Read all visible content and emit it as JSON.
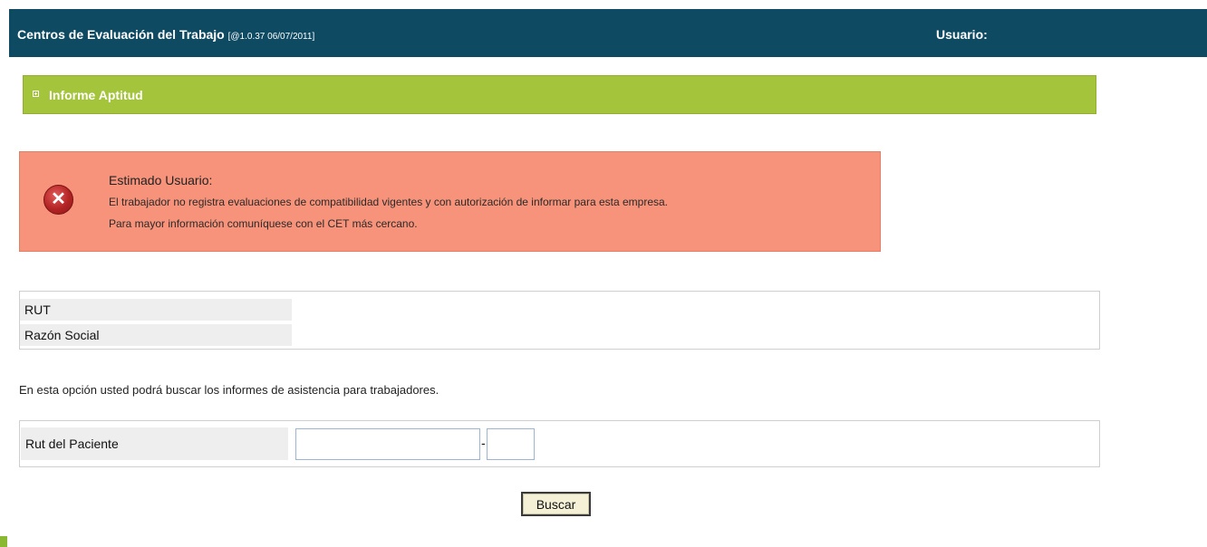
{
  "header": {
    "title": "Centros de Evaluación del Trabajo",
    "version": "[@1.0.37 06/07/2011]",
    "user_label": "Usuario:"
  },
  "section": {
    "title": "Informe Aptitud"
  },
  "alert": {
    "type": "error",
    "title": "Estimado Usuario:",
    "line1": "El trabajador no registra evaluaciones de compatibilidad vigentes y con autorización de informar para esta empresa.",
    "line2": "Para mayor información comuníquese con el CET más cercano."
  },
  "company": {
    "rut_label": "RUT",
    "razon_social_label": "Razón Social"
  },
  "info_text": "En esta opción usted podrá buscar los informes de asistencia para trabajadores.",
  "search": {
    "label": "Rut del Paciente",
    "rut_value": "",
    "dv_value": "",
    "separator": "-",
    "button_label": "Buscar"
  },
  "colors": {
    "header_bg": "#0f4a63",
    "section_bg": "#a4c43b",
    "alert_bg": "#f6937a",
    "error_icon": "#b32424"
  }
}
